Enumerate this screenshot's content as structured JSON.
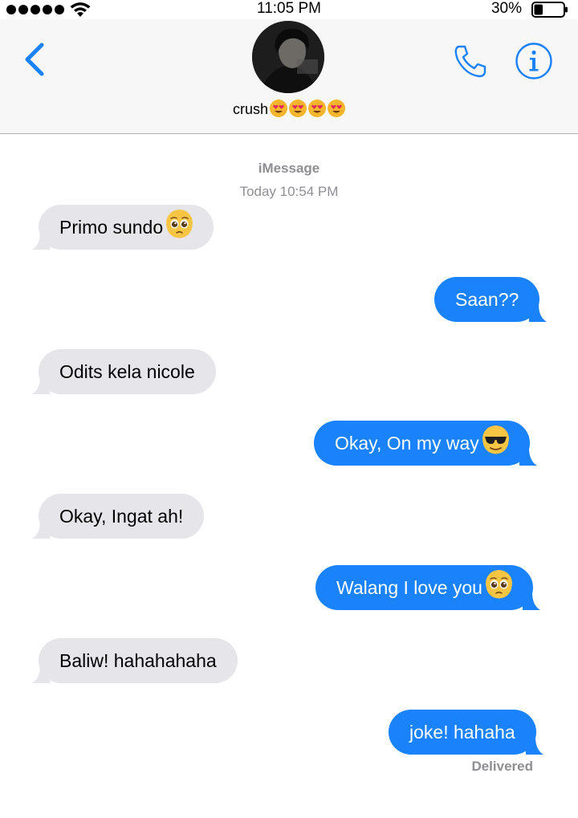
{
  "status_bar": {
    "time": "11:05 PM",
    "battery_percent": "30%",
    "battery_level": 0.3,
    "signal_bars": 5,
    "icons": [
      "signal-dots-icon",
      "wifi-icon",
      "battery-icon"
    ]
  },
  "header": {
    "contact_name": "crush",
    "name_emojis": [
      "heart-eyes-emoji",
      "heart-eyes-emoji",
      "heart-eyes-emoji",
      "heart-eyes-emoji"
    ],
    "icons": {
      "back": "chevron-left-icon",
      "call": "phone-icon",
      "info": "info-icon"
    }
  },
  "conversation": {
    "service": "iMessage",
    "timestamp": "Today 10:54 PM",
    "messages": [
      {
        "from": "them",
        "text": "Primo sundo",
        "emoji": "pleading-face-emoji"
      },
      {
        "from": "me",
        "text": "Saan??"
      },
      {
        "from": "them",
        "text": "Odits kela nicole"
      },
      {
        "from": "me",
        "text": "Okay, On my way",
        "emoji": "sunglasses-face-emoji"
      },
      {
        "from": "them",
        "text": "Okay, Ingat ah!"
      },
      {
        "from": "me",
        "text": "Walang I love you",
        "emoji": "pleading-face-emoji"
      },
      {
        "from": "them",
        "text": "Baliw! hahahahaha"
      },
      {
        "from": "me",
        "text": "joke! hahaha"
      }
    ],
    "delivery_status": "Delivered"
  },
  "colors": {
    "accent": "#1a82fb",
    "incoming_bubble": "#e5e5ea",
    "outgoing_bubble": "#1a82fb",
    "meta_text": "#8e8e93",
    "header_bg": "#f7f7f8"
  }
}
